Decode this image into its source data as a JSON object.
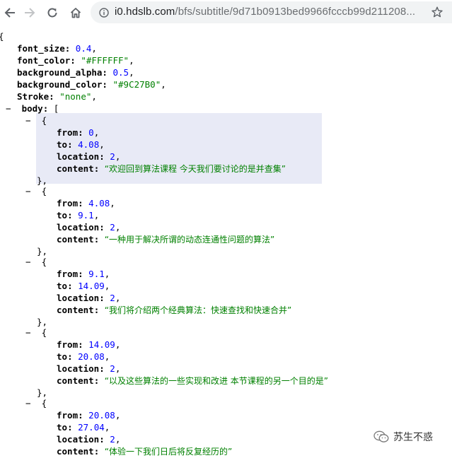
{
  "browser": {
    "url_host": "i0.hdslb.com",
    "url_path": "/bfs/subtitle/9d71b0913bed9966fcccb99d211208..."
  },
  "json": {
    "open_brace": "{",
    "meta": [
      {
        "key": "font_size",
        "value": "0.4",
        "kind": "num"
      },
      {
        "key": "font_color",
        "value": "\"#FFFFFF\"",
        "kind": "str"
      },
      {
        "key": "background_alpha",
        "value": "0.5",
        "kind": "num"
      },
      {
        "key": "background_color",
        "value": "\"#9C27B0\"",
        "kind": "str"
      },
      {
        "key": "Stroke",
        "value": "\"none\"",
        "kind": "str"
      }
    ],
    "body_key": "body",
    "body_open": "[",
    "toggle": "−",
    "item_open": "{",
    "item_close": "},",
    "labels": {
      "from": "from",
      "to": "to",
      "location": "location",
      "content": "content"
    },
    "items": [
      {
        "from": "0",
        "to": "4.08",
        "location": "2",
        "content": "“欢迎回到算法课程 今天我们要讨论的是并查集”"
      },
      {
        "from": "4.08",
        "to": "9.1",
        "location": "2",
        "content": "“一种用于解决所谓的动态连通性问题的算法”"
      },
      {
        "from": "9.1",
        "to": "14.09",
        "location": "2",
        "content": "“我们将介绍两个经典算法：快速查找和快速合并”"
      },
      {
        "from": "14.09",
        "to": "20.08",
        "location": "2",
        "content": "“以及这些算法的一些实现和改进 本节课程的另一个目的是”"
      },
      {
        "from": "20.08",
        "to": "27.04",
        "location": "2",
        "content": "“体验一下我们日后将反复经历的”"
      }
    ]
  },
  "watermark": {
    "text": "苏生不惑"
  }
}
